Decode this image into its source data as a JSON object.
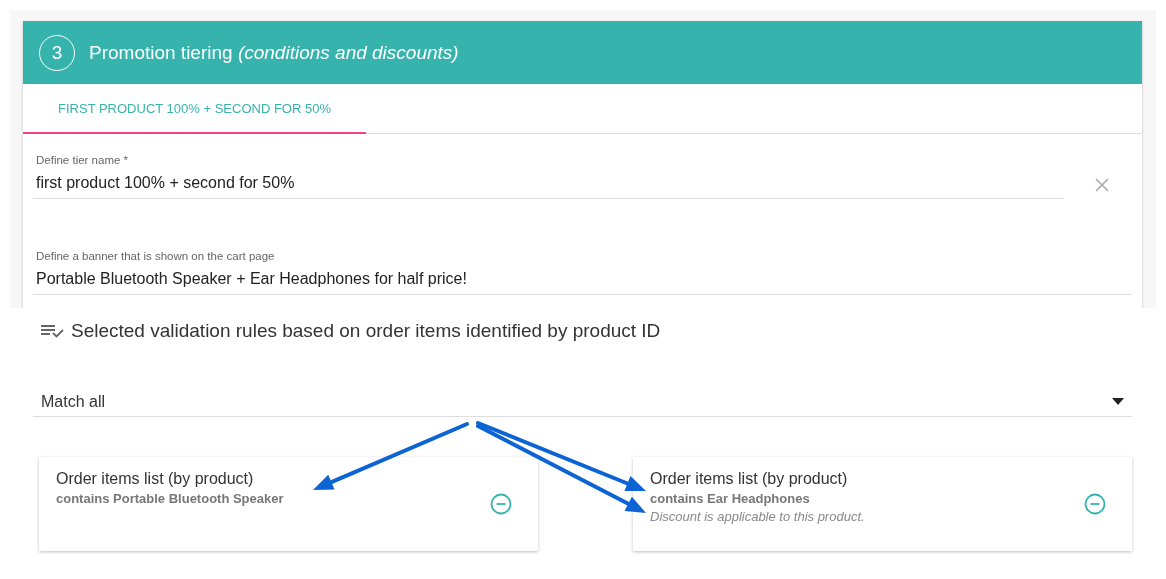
{
  "step": {
    "number": "3",
    "title": "Promotion tiering *(conditions and discounts)*"
  },
  "tabs": [
    {
      "label": "FIRST PRODUCT 100% + SECOND FOR 50%",
      "selected": true
    }
  ],
  "fields": [
    {
      "label": "Define tier name *",
      "value": "first product 100% + second for 50%",
      "removable": true
    },
    {
      "label": "Define a banner that is shown on the cart page",
      "value": "Portable Bluetooth Speaker + Ear Headphones for half price!",
      "removable": false
    }
  ],
  "rules": {
    "title": "Selected validation rules based on order items identified by product ID",
    "match": {
      "value": "Match all"
    },
    "cards": [
      {
        "title": "Order items list (by product)",
        "condition": "contains Portable Bluetooth Speaker"
      },
      {
        "title": "Order items list (by product)",
        "condition": "contains Ear Headphones",
        "note": "Discount is applicable to this product."
      }
    ]
  }
}
